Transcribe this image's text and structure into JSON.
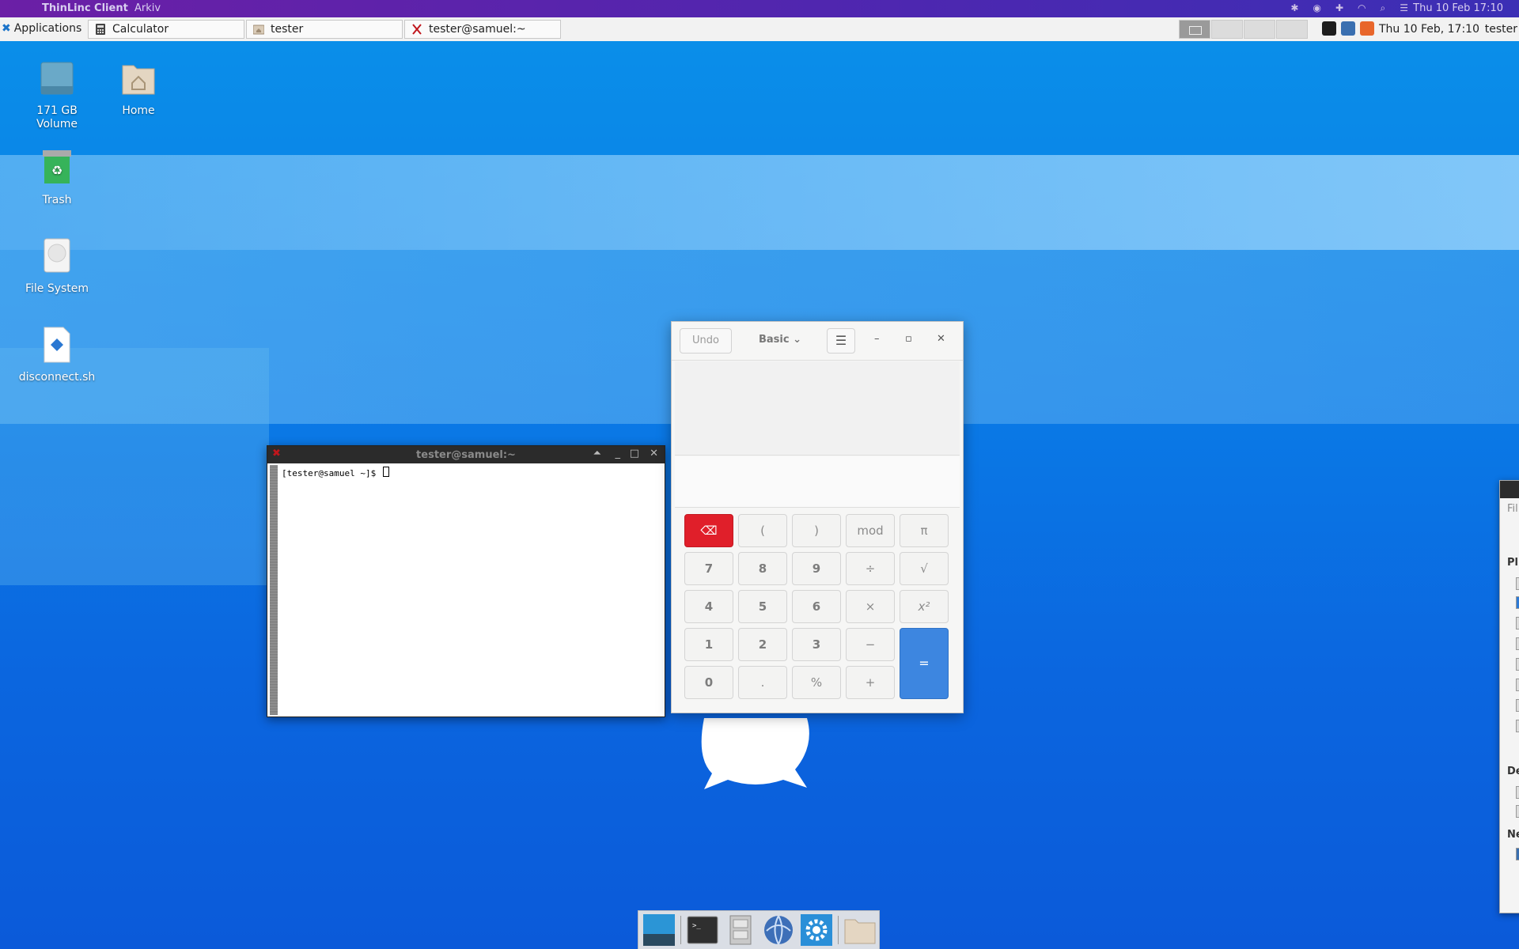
{
  "macbar": {
    "app_name": "ThinLinc Client",
    "menu_file": "Arkiv",
    "clock": "Thu 10 Feb  17:10"
  },
  "panel": {
    "applications_label": "Applications",
    "tasks": [
      {
        "label": "Calculator"
      },
      {
        "label": "tester"
      },
      {
        "label": "tester@samuel:~"
      }
    ],
    "clock": "Thu 10 Feb, 17:10",
    "user": "tester"
  },
  "desktop": {
    "icons": [
      {
        "label": "171 GB\nVolume"
      },
      {
        "label": "Home"
      },
      {
        "label": "Trash"
      },
      {
        "label": "File System"
      },
      {
        "label": "disconnect.sh"
      }
    ]
  },
  "terminal": {
    "title": "tester@samuel:~",
    "prompt": "[tester@samuel ~]$ "
  },
  "calculator": {
    "undo_label": "Undo",
    "mode_label": "Basic",
    "keys": [
      "(",
      ")",
      "mod",
      "π",
      "7",
      "8",
      "9",
      "÷",
      "√",
      "4",
      "5",
      "6",
      "×",
      "x²",
      "1",
      "2",
      "3",
      "−",
      "=",
      "0",
      ".",
      "%",
      "+"
    ]
  },
  "file_manager": {
    "labels": [
      "Fil",
      "Pl",
      "De",
      "Ne"
    ]
  },
  "colors": {
    "accent_blue": "#3d86e0",
    "delete_red": "#e01f2a",
    "panel_bg": "#f2f2f2"
  }
}
